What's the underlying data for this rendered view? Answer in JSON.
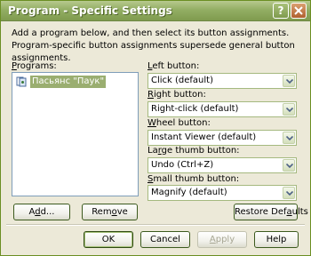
{
  "window": {
    "title": "Program - Specific Settings",
    "help_button": "?",
    "close_button": "✕"
  },
  "intro_text": "Add a program below, and then select its button assignments. Program-specific button assignments supersede general button assignments.",
  "programs": {
    "label_prefix": "",
    "label_hotkey": "P",
    "label_rest": "rograms:",
    "items": [
      {
        "name": "Пасьянс \"Паук\"",
        "icon": "card-game-icon",
        "selected": true
      }
    ]
  },
  "assignments": {
    "left_button": {
      "label_hotkey": "L",
      "label_rest": "eft button:",
      "value": "Click (default)"
    },
    "right_button": {
      "label_hotkey": "R",
      "label_rest": "ight button:",
      "value": "Right-click (default)"
    },
    "wheel_button": {
      "label_hotkey": "W",
      "label_rest": "heel button:",
      "value": "Instant Viewer (default)"
    },
    "large_thumb_button": {
      "label_prefix": "La",
      "label_hotkey": "r",
      "label_rest": "ge thumb button:",
      "value": "Undo (Ctrl+Z)"
    },
    "small_thumb_button": {
      "label_hotkey": "S",
      "label_rest": "mall thumb button:",
      "value": "Magnify (default)"
    }
  },
  "buttons": {
    "add_prefix": "A",
    "add_hotkey": "d",
    "add_rest": "d...",
    "remove_prefix": "Rem",
    "remove_hotkey": "o",
    "remove_rest": "ve",
    "restore_prefix": "Restore Def",
    "restore_hotkey": "a",
    "restore_rest": "ults",
    "ok": "OK",
    "cancel": "Cancel",
    "apply_hotkey": "A",
    "apply_rest": "pply",
    "help": "Help"
  },
  "colors": {
    "titlebar": "#93AE64",
    "selection": "#9AAE70",
    "dialog_bg": "#ECE9D8"
  }
}
